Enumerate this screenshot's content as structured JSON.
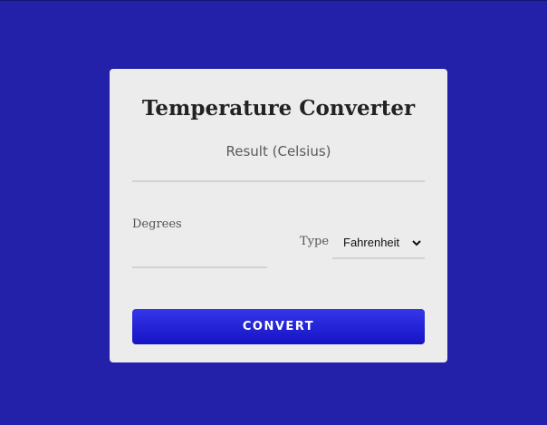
{
  "app": {
    "title": "Temperature Converter"
  },
  "result": {
    "label": "Result (Celsius)"
  },
  "degrees": {
    "label": "Degrees",
    "value": ""
  },
  "type": {
    "label": "Type",
    "selected": "Fahrenheit"
  },
  "actions": {
    "convert_label": "CONVERT"
  },
  "colors": {
    "background": "#2321a9",
    "card": "#ececec",
    "button": "#2222dd",
    "underline": "#d2d2d2"
  },
  "icons": {
    "select_arrow": "chevron-down-icon"
  }
}
